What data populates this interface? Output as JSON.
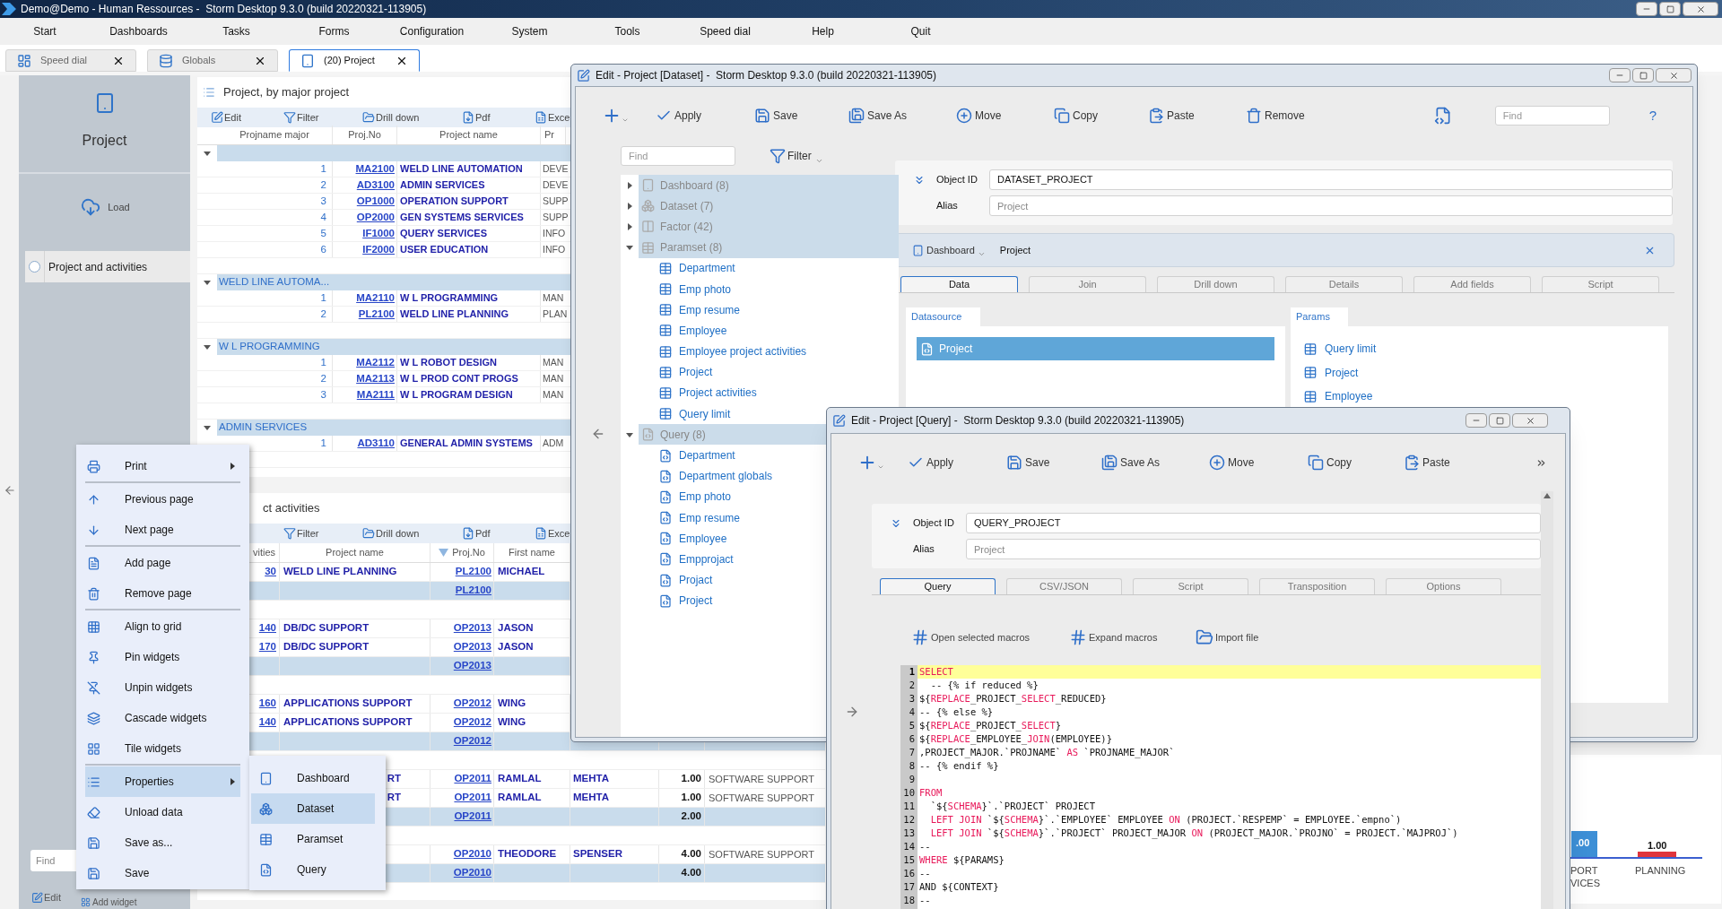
{
  "title_bar": {
    "title": "Demo@Demo - Human Ressources -  Storm Desktop 9.3.0 (build 20220321-113905)"
  },
  "menu": [
    "Start",
    "Dashboards",
    "Tasks",
    "Forms",
    "Configuration",
    "System",
    "Tools",
    "Speed dial",
    "Help",
    "Quit"
  ],
  "tabs": [
    {
      "label": "Speed dial",
      "selected": false
    },
    {
      "label": "Globals",
      "selected": false
    },
    {
      "label": "(20) Project",
      "selected": true
    }
  ],
  "sidebar": {
    "title": "Project",
    "load": "Load",
    "items": [
      {
        "label": "Project and activities",
        "selected": false
      }
    ],
    "find_placeholder": "Find",
    "edit": "Edit",
    "add_widget": "Add widget"
  },
  "widget_projects": {
    "title": "Project, by major project",
    "toolbar": [
      "Edit",
      "Filter",
      "Drill down",
      "Pdf",
      "Exce"
    ],
    "columns": [
      "Projname major",
      "Proj.No",
      "Project name",
      "Pr"
    ],
    "rows": [
      {
        "kind": "group",
        "expanded": true
      },
      {
        "kind": "item",
        "number": "1",
        "proj_no": "MA2100",
        "name": "WELD LINE AUTOMATION",
        "column_4": "DEVE"
      },
      {
        "kind": "item",
        "number": "2",
        "proj_no": "AD3100",
        "name": "ADMIN SERVICES",
        "column_4": "DEVE"
      },
      {
        "kind": "item",
        "number": "3",
        "proj_no": "OP1000",
        "name": "OPERATION SUPPORT",
        "column_4": "SUPP"
      },
      {
        "kind": "item",
        "number": "4",
        "proj_no": "OP2000",
        "name": "GEN SYSTEMS SERVICES",
        "column_4": "SUPP"
      },
      {
        "kind": "item",
        "number": "5",
        "proj_no": "IF1000",
        "name": "QUERY SERVICES",
        "column_4": "INFO"
      },
      {
        "kind": "item",
        "number": "6",
        "proj_no": "IF2000",
        "name": "USER EDUCATION",
        "column_4": "INFO"
      },
      {
        "kind": "blank"
      },
      {
        "kind": "group",
        "expanded": true,
        "label": "WELD LINE AUTOMA..."
      },
      {
        "kind": "item",
        "number": "1",
        "proj_no": "MA2110",
        "name": "W L PROGRAMMING",
        "column_4": "MAN"
      },
      {
        "kind": "item",
        "number": "2",
        "proj_no": "PL2100",
        "name": "WELD LINE PLANNING",
        "column_4": "PLAN"
      },
      {
        "kind": "blank"
      },
      {
        "kind": "group",
        "expanded": true,
        "label": "W L PROGRAMMING"
      },
      {
        "kind": "item",
        "number": "1",
        "proj_no": "MA2112",
        "name": "W L ROBOT DESIGN",
        "column_4": "MAN"
      },
      {
        "kind": "item",
        "number": "2",
        "proj_no": "MA2113",
        "name": "W L PROD CONT PROGS",
        "column_4": "MAN"
      },
      {
        "kind": "item",
        "number": "3",
        "proj_no": "MA2111",
        "name": "W L PROGRAM DESIGN",
        "column_4": "MAN"
      },
      {
        "kind": "blank"
      },
      {
        "kind": "group",
        "expanded": true,
        "label": "ADMIN SERVICES"
      },
      {
        "kind": "item",
        "number": "1",
        "proj_no": "AD3110",
        "name": "GENERAL ADMIN SYSTEMS",
        "column_4": "ADM"
      },
      {
        "kind": "blank"
      }
    ]
  },
  "widget_activities": {
    "title": "ct activities",
    "toolbar": [
      "Filter",
      "Drill down",
      "Pdf",
      "Exce"
    ],
    "columns": [
      "vities",
      "Project name",
      "Proj.No",
      "First name"
    ],
    "rows": [
      {
        "kind": "item",
        "count": "30",
        "name": "WELD LINE PLANNING",
        "proj_no": "PL2100",
        "first_name": "MICHAEL"
      },
      {
        "kind": "group",
        "proj_no": "PL2100"
      },
      {
        "kind": "blank"
      },
      {
        "kind": "item",
        "count": "140",
        "name": "DB/DC SUPPORT",
        "proj_no": "OP2013",
        "first_name": "JASON"
      },
      {
        "kind": "item",
        "count": "170",
        "name": "DB/DC SUPPORT",
        "proj_no": "OP2013",
        "first_name": "JASON"
      },
      {
        "kind": "group",
        "proj_no": "OP2013"
      },
      {
        "kind": "blank"
      },
      {
        "kind": "item",
        "count": "160",
        "name": "APPLICATIONS SUPPORT",
        "proj_no": "OP2012",
        "first_name": "WING"
      },
      {
        "kind": "item",
        "count": "140",
        "name": "APPLICATIONS SUPPORT",
        "proj_no": "OP2012",
        "first_name": "WING"
      },
      {
        "kind": "group",
        "proj_no": "OP2012"
      },
      {
        "kind": "blank"
      },
      {
        "kind": "item",
        "name_end": "RT",
        "proj_no": "OP2011",
        "first_name": "RAMLAL",
        "last_name": "MEHTA",
        "amount": "1.00",
        "department": "SOFTWARE SUPPORT"
      },
      {
        "kind": "item",
        "name_end": "RT",
        "proj_no": "OP2011",
        "first_name": "RAMLAL",
        "last_name": "MEHTA",
        "amount": "1.00",
        "department": "SOFTWARE SUPPORT"
      },
      {
        "kind": "group",
        "proj_no": "OP2011",
        "amount": "2.00"
      },
      {
        "kind": "blank"
      },
      {
        "kind": "item",
        "proj_no": "OP2010",
        "first_name": "THEODORE",
        "last_name": "SPENSER",
        "amount": "4.00",
        "department": "SOFTWARE SUPPORT"
      },
      {
        "kind": "group",
        "proj_no": "OP2010",
        "amount": "4.00"
      }
    ]
  },
  "chart_widget": {
    "bars": [
      {
        "label": ".00",
        "color": "#3d8fd6"
      },
      {
        "label": "1.00",
        "color": "#e0343c"
      }
    ],
    "categories": [
      "PORT\nVICES",
      "PLANNING"
    ]
  },
  "context_menu": {
    "groups": [
      [
        {
          "label": "Print",
          "submenu": true,
          "selected": false
        }
      ],
      [
        {
          "label": "Previous page",
          "submenu": false,
          "selected": false
        },
        {
          "label": "Next page",
          "submenu": false,
          "selected": false
        }
      ],
      [
        {
          "label": "Add page",
          "submenu": false,
          "selected": false
        },
        {
          "label": "Remove page",
          "submenu": false,
          "selected": false
        }
      ],
      [
        {
          "label": "Align to grid",
          "submenu": false,
          "selected": false
        },
        {
          "label": "Pin widgets",
          "submenu": false,
          "selected": false
        },
        {
          "label": "Unpin widgets",
          "submenu": false,
          "selected": false
        },
        {
          "label": "Cascade widgets",
          "submenu": false,
          "selected": false
        },
        {
          "label": "Tile widgets",
          "submenu": false,
          "selected": false
        }
      ],
      [
        {
          "label": "Properties",
          "submenu": true,
          "selected": true
        },
        {
          "label": "Unload data",
          "submenu": false,
          "selected": false
        },
        {
          "label": "Save as...",
          "submenu": false,
          "selected": false
        },
        {
          "label": "Save",
          "submenu": false,
          "selected": false
        }
      ]
    ],
    "submenu": [
      {
        "label": "Dashboard",
        "selected": false
      },
      {
        "label": "Dataset",
        "selected": true
      },
      {
        "label": "Paramset",
        "selected": false
      },
      {
        "label": "Query",
        "selected": false
      }
    ]
  },
  "dataset_window": {
    "title": "Edit - Project [Dataset] -  Storm Desktop 9.3.0 (build 20220321-113905)",
    "toolbar": [
      "Apply",
      "Save",
      "Save As",
      "Move",
      "Copy",
      "Paste",
      "Remove"
    ],
    "find_placeholder": "Find",
    "help": "?",
    "tree_find_placeholder": "Find",
    "filter": "Filter",
    "tree": [
      {
        "kind": "dashboard",
        "label": "Dashboard (8)",
        "expanded": false
      },
      {
        "kind": "dataset",
        "label": "Dataset (7)",
        "expanded": false
      },
      {
        "kind": "factor",
        "label": "Factor (42)",
        "expanded": false
      },
      {
        "kind": "paramset",
        "label": "Paramset (8)",
        "expanded": true,
        "children": [
          "Department",
          "Emp photo",
          "Emp resume",
          "Employee",
          "Employee project activities",
          "Project",
          "Project activities",
          "Query limit"
        ]
      },
      {
        "kind": "query",
        "label": "Query (8)",
        "expanded": true,
        "children": [
          "Department",
          "Department globals",
          "Emp photo",
          "Emp resume",
          "Employee",
          "Empprojact",
          "Projact",
          "Project"
        ]
      }
    ],
    "object_id_label": "Object ID",
    "object_id": "DATASET_PROJECT",
    "alias_label": "Alias",
    "alias_placeholder": "Project",
    "dashboard": "Dashboard",
    "dashboard_value": "Project",
    "tabs": [
      {
        "label": "Data",
        "selected": true
      },
      {
        "label": "Join",
        "selected": false
      },
      {
        "label": "Drill down",
        "selected": false
      },
      {
        "label": "Details",
        "selected": false
      },
      {
        "label": "Add fields",
        "selected": false
      },
      {
        "label": "Script",
        "selected": false
      }
    ],
    "datasource": {
      "title": "Datasource",
      "items": [
        {
          "label": "Project",
          "selected": true
        }
      ]
    },
    "params": {
      "title": "Params",
      "items": [
        "Query limit",
        "Project",
        "Employee"
      ]
    }
  },
  "query_window": {
    "title": "Edit - Project [Query] -  Storm Desktop 9.3.0 (build 20220321-113905)",
    "toolbar": [
      "Apply",
      "Save",
      "Save As",
      "Move",
      "Copy",
      "Paste"
    ],
    "object_id_label": "Object ID",
    "object_id": "QUERY_PROJECT",
    "alias_label": "Alias",
    "alias_placeholder": "Project",
    "tabs": [
      {
        "label": "Query",
        "selected": true
      },
      {
        "label": "CSV/JSON",
        "selected": false
      },
      {
        "label": "Script",
        "selected": false
      },
      {
        "label": "Transposition",
        "selected": false
      },
      {
        "label": "Options",
        "selected": false
      }
    ],
    "macro_buttons": [
      "Open selected macros",
      "Expand macros",
      "Import file"
    ],
    "code": [
      {
        "number": "1",
        "highlighted": true,
        "tokens": [
          {
            "text": "SELECT",
            "kind": "keyword"
          }
        ]
      },
      {
        "number": "2",
        "highlighted": false,
        "tokens": [
          {
            "text": "  -- {% if reduced %}",
            "kind": "text"
          }
        ]
      },
      {
        "number": "3",
        "highlighted": false,
        "tokens": [
          {
            "text": "${",
            "kind": "text"
          },
          {
            "text": "REPLACE",
            "kind": "keyword"
          },
          {
            "text": "_PROJECT_",
            "kind": "text"
          },
          {
            "text": "SELECT",
            "kind": "keyword"
          },
          {
            "text": "_REDUCED}",
            "kind": "text"
          }
        ]
      },
      {
        "number": "4",
        "highlighted": false,
        "tokens": [
          {
            "text": "-- {% else %}",
            "kind": "text"
          }
        ]
      },
      {
        "number": "5",
        "highlighted": false,
        "tokens": [
          {
            "text": "${",
            "kind": "text"
          },
          {
            "text": "REPLACE",
            "kind": "keyword"
          },
          {
            "text": "_PROJECT_",
            "kind": "text"
          },
          {
            "text": "SELECT",
            "kind": "keyword"
          },
          {
            "text": "}",
            "kind": "text"
          }
        ]
      },
      {
        "number": "6",
        "highlighted": false,
        "tokens": [
          {
            "text": "${",
            "kind": "text"
          },
          {
            "text": "REPLACE",
            "kind": "keyword"
          },
          {
            "text": "_EMPLOYEE_",
            "kind": "text"
          },
          {
            "text": "JOIN",
            "kind": "keyword"
          },
          {
            "text": "(EMPLOYEE)}",
            "kind": "text"
          }
        ]
      },
      {
        "number": "7",
        "highlighted": false,
        "tokens": [
          {
            "text": ",PROJECT_MAJOR.`PROJNAME` ",
            "kind": "text"
          },
          {
            "text": "AS",
            "kind": "keyword"
          },
          {
            "text": " `PROJNAME_MAJOR`",
            "kind": "text"
          }
        ]
      },
      {
        "number": "8",
        "highlighted": false,
        "tokens": [
          {
            "text": "-- {% endif %}",
            "kind": "text"
          }
        ]
      },
      {
        "number": "9",
        "highlighted": false
      },
      {
        "number": "10",
        "highlighted": false,
        "tokens": [
          {
            "text": "FROM",
            "kind": "keyword"
          }
        ]
      },
      {
        "number": "11",
        "highlighted": false,
        "tokens": [
          {
            "text": "  `${",
            "kind": "text"
          },
          {
            "text": "SCHEMA",
            "kind": "keyword"
          },
          {
            "text": "}`.`PROJECT` PROJECT",
            "kind": "text"
          }
        ]
      },
      {
        "number": "12",
        "highlighted": false,
        "tokens": [
          {
            "text": "  LEFT JOIN",
            "kind": "keyword"
          },
          {
            "text": " `${",
            "kind": "text"
          },
          {
            "text": "SCHEMA",
            "kind": "keyword"
          },
          {
            "text": "}`.`EMPLOYEE` EMPLOYEE ",
            "kind": "text"
          },
          {
            "text": "ON",
            "kind": "keyword"
          },
          {
            "text": " (PROJECT.`RESPEMP` = EMPLOYEE.`empno`)",
            "kind": "text"
          }
        ]
      },
      {
        "number": "13",
        "highlighted": false,
        "tokens": [
          {
            "text": "  LEFT JOIN",
            "kind": "keyword"
          },
          {
            "text": " `${",
            "kind": "text"
          },
          {
            "text": "SCHEMA",
            "kind": "keyword"
          },
          {
            "text": "}`.`PROJECT` PROJECT_MAJOR ",
            "kind": "text"
          },
          {
            "text": "ON",
            "kind": "keyword"
          },
          {
            "text": " (PROJECT_MAJOR.`PROJNO` = PROJECT.`MAJPROJ`)",
            "kind": "text"
          }
        ]
      },
      {
        "number": "14",
        "highlighted": false,
        "tokens": [
          {
            "text": "--",
            "kind": "text"
          }
        ]
      },
      {
        "number": "15",
        "highlighted": false,
        "tokens": [
          {
            "text": "WHERE",
            "kind": "keyword"
          },
          {
            "text": " ${PARAMS}",
            "kind": "text"
          }
        ]
      },
      {
        "number": "16",
        "highlighted": false,
        "tokens": [
          {
            "text": "--",
            "kind": "text"
          }
        ]
      },
      {
        "number": "17",
        "highlighted": false,
        "tokens": [
          {
            "text": "AND ${CONTEXT}",
            "kind": "text"
          }
        ]
      },
      {
        "number": "18",
        "highlighted": false,
        "tokens": [
          {
            "text": "--",
            "kind": "text"
          }
        ]
      }
    ]
  }
}
